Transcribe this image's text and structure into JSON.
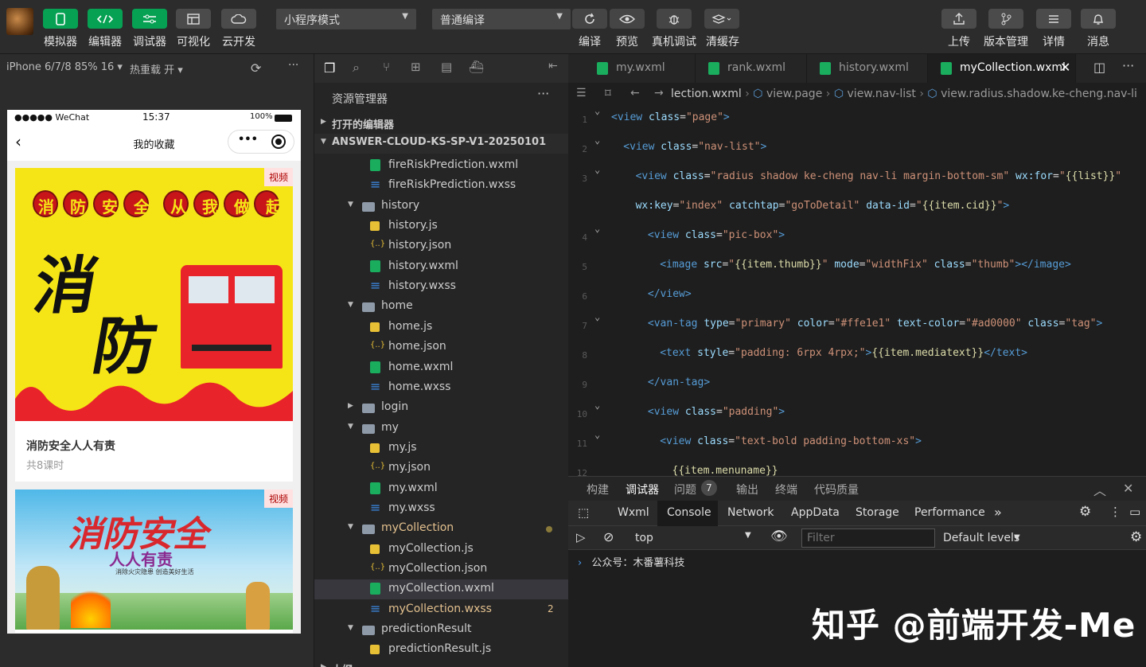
{
  "toolbar": {
    "left_buttons": [
      {
        "label": "模拟器",
        "icon": "phone-icon"
      },
      {
        "label": "编辑器",
        "icon": "code-icon"
      },
      {
        "label": "调试器",
        "icon": "sliders-icon"
      },
      {
        "label": "可视化",
        "icon": "layout-icon"
      },
      {
        "label": "云开发",
        "icon": "cloud-icon"
      }
    ],
    "mode_select": "小程序模式",
    "compile_select": "普通编译",
    "mid_buttons": [
      {
        "label": "编译",
        "icon": "refresh-icon"
      },
      {
        "label": "预览",
        "icon": "eye-icon"
      },
      {
        "label": "真机调试",
        "icon": "bug-icon"
      },
      {
        "label": "清缓存",
        "icon": "layers-icon"
      }
    ],
    "right_buttons": [
      {
        "label": "上传",
        "icon": "upload-icon"
      },
      {
        "label": "版本管理",
        "icon": "branch-icon"
      },
      {
        "label": "详情",
        "icon": "menu-icon"
      },
      {
        "label": "消息",
        "icon": "bell-icon"
      }
    ],
    "accent": "#07a153"
  },
  "simulator": {
    "device": "iPhone 6/7/8 85% 16 ▾",
    "hot_reload": "热重载 开 ▾",
    "status_left": "●●●●● WeChat",
    "status_time": "15:37",
    "status_battery": "100%",
    "page_title": "我的收藏",
    "cards": [
      {
        "tag": "视频",
        "banner_title": "消防安全从我做起",
        "big_char1": "消",
        "big_char2": "防",
        "title": "消防安全人人有责",
        "subtitle": "共8课时"
      },
      {
        "tag": "视频",
        "banner_title": "消防安全",
        "banner_sub": "人人有责",
        "banner_small": "消除火灾隐患 创造美好生活"
      }
    ]
  },
  "explorer": {
    "title": "资源管理器",
    "open_editors": "打开的编辑器",
    "project": "ANSWER-CLOUD-KS-SP-V1-20250101",
    "tree": [
      {
        "label": "fireRiskPrediction.wxml",
        "type": "wxml",
        "depth": 2
      },
      {
        "label": "fireRiskPrediction.wxss",
        "type": "wxss",
        "depth": 2
      },
      {
        "label": "history",
        "type": "folder-open",
        "depth": 1
      },
      {
        "label": "history.js",
        "type": "js",
        "depth": 2
      },
      {
        "label": "history.json",
        "type": "json",
        "depth": 2
      },
      {
        "label": "history.wxml",
        "type": "wxml",
        "depth": 2
      },
      {
        "label": "history.wxss",
        "type": "wxss",
        "depth": 2
      },
      {
        "label": "home",
        "type": "folder-open",
        "depth": 1
      },
      {
        "label": "home.js",
        "type": "js",
        "depth": 2
      },
      {
        "label": "home.json",
        "type": "json",
        "depth": 2
      },
      {
        "label": "home.wxml",
        "type": "wxml",
        "depth": 2
      },
      {
        "label": "home.wxss",
        "type": "wxss",
        "depth": 2
      },
      {
        "label": "login",
        "type": "folder",
        "depth": 1
      },
      {
        "label": "my",
        "type": "folder-open",
        "depth": 1
      },
      {
        "label": "my.js",
        "type": "js",
        "depth": 2
      },
      {
        "label": "my.json",
        "type": "json",
        "depth": 2
      },
      {
        "label": "my.wxml",
        "type": "wxml",
        "depth": 2
      },
      {
        "label": "my.wxss",
        "type": "wxss",
        "depth": 2
      },
      {
        "label": "myCollection",
        "type": "folder-open",
        "depth": 1,
        "modified": true
      },
      {
        "label": "myCollection.js",
        "type": "js",
        "depth": 2
      },
      {
        "label": "myCollection.json",
        "type": "json",
        "depth": 2
      },
      {
        "label": "myCollection.wxml",
        "type": "wxml",
        "depth": 2,
        "selected": true
      },
      {
        "label": "myCollection.wxss",
        "type": "wxss",
        "depth": 2,
        "modified": true,
        "badge": "2"
      },
      {
        "label": "predictionResult",
        "type": "folder-open",
        "depth": 1
      },
      {
        "label": "predictionResult.js",
        "type": "js",
        "depth": 2
      }
    ],
    "outline": "大纲"
  },
  "editor": {
    "tabs": [
      {
        "label": "my.wxml",
        "active": false
      },
      {
        "label": "rank.wxml",
        "active": false
      },
      {
        "label": "history.wxml",
        "active": false
      },
      {
        "label": "myCollection.wxml",
        "active": true
      }
    ],
    "breadcrumb": [
      "lection.wxml",
      "view.page",
      "view.nav-list",
      "view.radius.shadow.ke-cheng.nav-li"
    ],
    "lines": [
      {
        "num": "1",
        "fold": true,
        "indent": 0,
        "tokens": [
          [
            "t",
            "<view "
          ],
          [
            "a",
            "class"
          ],
          [
            "p",
            "="
          ],
          [
            "s",
            "\"page\""
          ],
          [
            "t",
            ">"
          ]
        ]
      },
      {
        "num": "2",
        "fold": true,
        "indent": 1,
        "tokens": [
          [
            "t",
            "<view "
          ],
          [
            "a",
            "class"
          ],
          [
            "p",
            "="
          ],
          [
            "s",
            "\"nav-list\""
          ],
          [
            "t",
            ">"
          ]
        ]
      },
      {
        "num": "3",
        "fold": true,
        "indent": 2,
        "tokens": [
          [
            "t",
            "<view "
          ],
          [
            "a",
            "class"
          ],
          [
            "p",
            "="
          ],
          [
            "s",
            "\"radius shadow ke-cheng nav-li margin-bottom-sm\""
          ],
          [
            "p",
            " "
          ],
          [
            "a",
            "wx:for"
          ],
          [
            "p",
            "="
          ],
          [
            "s",
            "\""
          ],
          [
            "m",
            "{{list}}"
          ],
          [
            "s",
            "\""
          ]
        ]
      },
      {
        "num": "",
        "fold": false,
        "indent": 2,
        "tokens": [
          [
            "a",
            "wx:key"
          ],
          [
            "p",
            "="
          ],
          [
            "s",
            "\"index\""
          ],
          [
            "p",
            " "
          ],
          [
            "a",
            "catchtap"
          ],
          [
            "p",
            "="
          ],
          [
            "s",
            "\"goToDetail\""
          ],
          [
            "p",
            " "
          ],
          [
            "a",
            "data-id"
          ],
          [
            "p",
            "="
          ],
          [
            "s",
            "\""
          ],
          [
            "m",
            "{{item.cid}}"
          ],
          [
            "s",
            "\""
          ],
          [
            "t",
            ">"
          ]
        ]
      },
      {
        "num": "4",
        "fold": true,
        "indent": 3,
        "tokens": [
          [
            "t",
            "<view "
          ],
          [
            "a",
            "class"
          ],
          [
            "p",
            "="
          ],
          [
            "s",
            "\"pic-box\""
          ],
          [
            "t",
            ">"
          ]
        ]
      },
      {
        "num": "5",
        "fold": false,
        "indent": 4,
        "tokens": [
          [
            "t",
            "<image "
          ],
          [
            "a",
            "src"
          ],
          [
            "p",
            "="
          ],
          [
            "s",
            "\""
          ],
          [
            "m",
            "{{item.thumb}}"
          ],
          [
            "s",
            "\""
          ],
          [
            "p",
            " "
          ],
          [
            "a",
            "mode"
          ],
          [
            "p",
            "="
          ],
          [
            "s",
            "\"widthFix\""
          ],
          [
            "p",
            " "
          ],
          [
            "a",
            "class"
          ],
          [
            "p",
            "="
          ],
          [
            "s",
            "\"thumb\""
          ],
          [
            "t",
            "></image>"
          ]
        ]
      },
      {
        "num": "6",
        "fold": false,
        "indent": 3,
        "tokens": [
          [
            "t",
            "</view>"
          ]
        ]
      },
      {
        "num": "7",
        "fold": true,
        "indent": 3,
        "tokens": [
          [
            "t",
            "<van-tag "
          ],
          [
            "a",
            "type"
          ],
          [
            "p",
            "="
          ],
          [
            "s",
            "\"primary\""
          ],
          [
            "p",
            " "
          ],
          [
            "a",
            "color"
          ],
          [
            "p",
            "="
          ],
          [
            "s",
            "\"#ffe1e1\""
          ],
          [
            "p",
            " "
          ],
          [
            "a",
            "text-color"
          ],
          [
            "p",
            "="
          ],
          [
            "s",
            "\"#ad0000\""
          ],
          [
            "p",
            " "
          ],
          [
            "a",
            "class"
          ],
          [
            "p",
            "="
          ],
          [
            "s",
            "\"tag\""
          ],
          [
            "t",
            ">"
          ]
        ]
      },
      {
        "num": "8",
        "fold": false,
        "indent": 4,
        "tokens": [
          [
            "t",
            "<text "
          ],
          [
            "a",
            "style"
          ],
          [
            "p",
            "="
          ],
          [
            "s",
            "\"padding: 6rpx 4rpx;\""
          ],
          [
            "t",
            ">"
          ],
          [
            "m",
            "{{item.mediatext}}"
          ],
          [
            "t",
            "</text>"
          ]
        ]
      },
      {
        "num": "9",
        "fold": false,
        "indent": 3,
        "tokens": [
          [
            "t",
            "</van-tag>"
          ]
        ]
      },
      {
        "num": "10",
        "fold": true,
        "indent": 3,
        "tokens": [
          [
            "t",
            "<view "
          ],
          [
            "a",
            "class"
          ],
          [
            "p",
            "="
          ],
          [
            "s",
            "\"padding\""
          ],
          [
            "t",
            ">"
          ]
        ]
      },
      {
        "num": "11",
        "fold": true,
        "indent": 4,
        "tokens": [
          [
            "t",
            "<view "
          ],
          [
            "a",
            "class"
          ],
          [
            "p",
            "="
          ],
          [
            "s",
            "\"text-bold padding-bottom-xs\""
          ],
          [
            "t",
            ">"
          ]
        ]
      },
      {
        "num": "12",
        "fold": false,
        "indent": 5,
        "tokens": [
          [
            "m",
            "{{item.menuname}}"
          ]
        ]
      }
    ]
  },
  "devtools": {
    "tabs": [
      "构建",
      "调试器",
      "问题",
      "输出",
      "终端",
      "代码质量"
    ],
    "issue_count": "7",
    "subtabs": [
      "Wxml",
      "Console",
      "Network",
      "AppData",
      "Storage",
      "Performance"
    ],
    "context": "top",
    "filter_placeholder": "Filter",
    "levels": "Default levels",
    "console_line": "公众号：木番薯科技"
  },
  "watermark": "知乎 @前端开发-Me"
}
